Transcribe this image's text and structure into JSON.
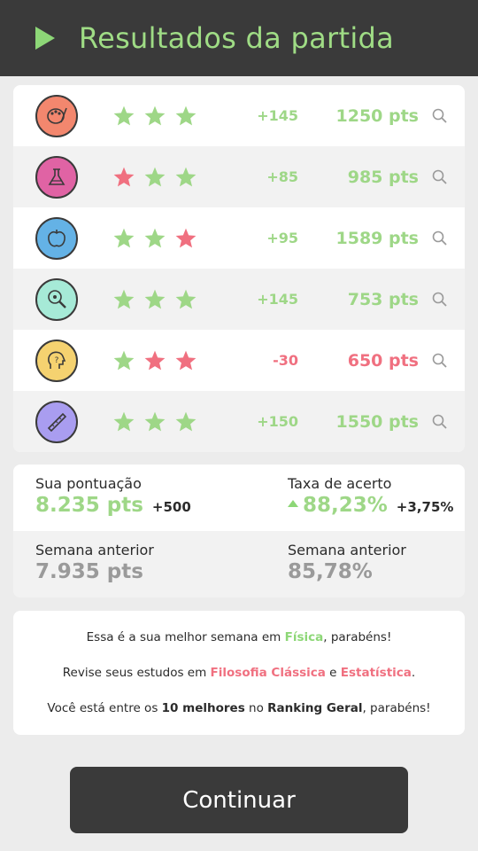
{
  "header": {
    "title": "Resultados da partida"
  },
  "results": [
    {
      "icon": "art-palette-icon",
      "color": "#f3876e",
      "stars": [
        "green",
        "green",
        "green"
      ],
      "delta": "+145",
      "delta_color": "green",
      "points": "1250 pts",
      "points_color": "green"
    },
    {
      "icon": "chemistry-flask-icon",
      "color": "#e063a4",
      "stars": [
        "red",
        "green",
        "green"
      ],
      "delta": "+85",
      "delta_color": "green",
      "points": "985 pts",
      "points_color": "green"
    },
    {
      "icon": "apple-physics-icon",
      "color": "#64b2e6",
      "stars": [
        "green",
        "green",
        "red"
      ],
      "delta": "+95",
      "delta_color": "green",
      "points": "1589 pts",
      "points_color": "green"
    },
    {
      "icon": "biology-magnifier-icon",
      "color": "#a6ead7",
      "stars": [
        "green",
        "green",
        "green"
      ],
      "delta": "+145",
      "delta_color": "green",
      "points": "753 pts",
      "points_color": "green"
    },
    {
      "icon": "philosophy-head-icon",
      "color": "#f5d270",
      "stars": [
        "green",
        "red",
        "red"
      ],
      "delta": "-30",
      "delta_color": "red",
      "points": "650 pts",
      "points_color": "red"
    },
    {
      "icon": "math-ruler-icon",
      "color": "#a99df0",
      "stars": [
        "green",
        "green",
        "green"
      ],
      "delta": "+150",
      "delta_color": "green",
      "points": "1550 pts",
      "points_color": "green"
    }
  ],
  "stats": {
    "score_label": "Sua pontuação",
    "score_value": "8.235 pts",
    "score_extra": "+500",
    "accuracy_label": "Taxa de acerto",
    "accuracy_value": "88,23%",
    "accuracy_extra": "+3,75%",
    "prev_score_label": "Semana anterior",
    "prev_score_value": "7.935 pts",
    "prev_accuracy_label": "Semana anterior",
    "prev_accuracy_value": "85,78%"
  },
  "messages": {
    "m1_a": "Essa é a sua melhor semana em ",
    "m1_b": "Física",
    "m1_c": ", parabéns!",
    "m2_a": "Revise seus estudos em ",
    "m2_b": "Filosofia Clássica",
    "m2_c": " e ",
    "m2_d": "Estatística",
    "m2_e": ".",
    "m3_a": "Você está entre os ",
    "m3_b": "10 melhores",
    "m3_c": " no ",
    "m3_d": "Ranking Geral",
    "m3_e": ", parabéns!"
  },
  "continue_label": "Continuar",
  "colors": {
    "green": "#9ed787",
    "red": "#f07080",
    "dark": "#3a3a3a"
  }
}
